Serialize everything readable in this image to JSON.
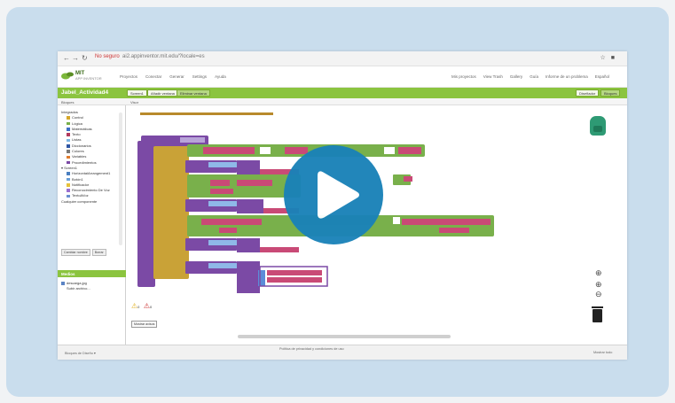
{
  "browser": {
    "security_warning": "No seguro",
    "url": "ai2.appinventor.mit.edu/?locale=es"
  },
  "app": {
    "logo_title": "MIT",
    "logo_subtitle": "APP INVENTOR",
    "menu": [
      "Proyectos",
      "Conectar",
      "Generar",
      "Settings",
      "Ayuda"
    ],
    "right_menu": [
      "Mis proyectos",
      "View Trash",
      "Gallery",
      "Guía",
      "Informe de un problema",
      "Español"
    ],
    "project_name": "Jabel_Actividad4",
    "toolbar": [
      "Screen1",
      "Añadir ventana",
      "Eliminar ventana"
    ],
    "view_buttons": [
      "Diseñador",
      "Bloques"
    ],
    "blocks_header": "Bloques",
    "viewer_header": "Visor"
  },
  "left_panel": {
    "root": "Integrados",
    "builtins": [
      {
        "label": "Control",
        "color": "#d6a72a"
      },
      {
        "label": "Lógica",
        "color": "#79b04b"
      },
      {
        "label": "Matemáticas",
        "color": "#3b6fc6"
      },
      {
        "label": "Texto",
        "color": "#b23a5e"
      },
      {
        "label": "Listas",
        "color": "#7db6e4"
      },
      {
        "label": "Diccionarios",
        "color": "#2f56a4"
      },
      {
        "label": "Colores",
        "color": "#7a7a7a"
      },
      {
        "label": "Variables",
        "color": "#e07b2c"
      },
      {
        "label": "Procedimientos",
        "color": "#7b4aa5"
      }
    ],
    "components": [
      "Screen1",
      "HorizontalArrangement1",
      "Botón1",
      "Notificador",
      "Reconocimiento De Voz",
      "TextoAVoz"
    ],
    "any_component": "Cualquier componente",
    "buttons": [
      "Cambiar nombre",
      "Borrar"
    ],
    "media_header": "Medios",
    "media_items": [
      "descarga.jpg",
      "Subir archivo..."
    ]
  },
  "workspace": {
    "show_warnings": "Mostrar avisos",
    "warning_count": "0",
    "error_count": "0"
  },
  "bottom": {
    "left_text": "Bloques de Diseño ▾",
    "center_text": "Política de privacidad y condiciones de uso",
    "right_text": "Mostrar todo"
  },
  "player": {
    "play_icon": "play-icon",
    "accent_color": "#1a82b8"
  }
}
